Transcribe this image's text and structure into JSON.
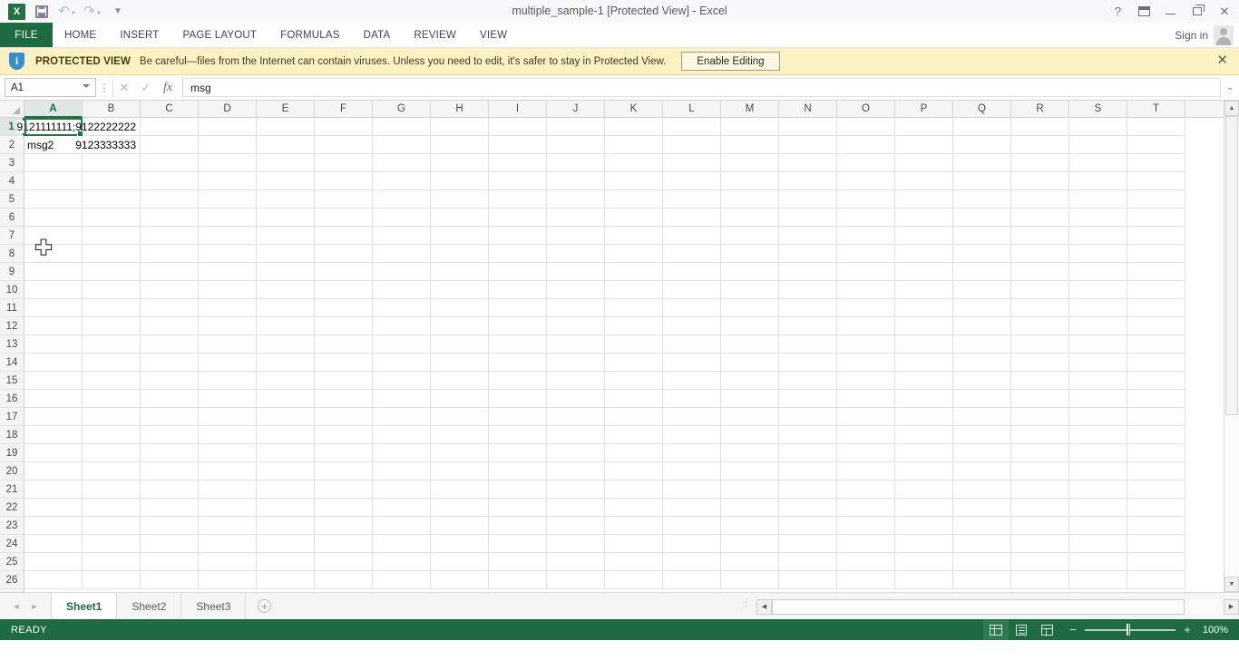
{
  "window": {
    "title": "multiple_sample-1  [Protected View] - Excel",
    "quick_access": [
      {
        "name": "excel-logo",
        "label": "X"
      },
      {
        "name": "save",
        "label": "Save"
      },
      {
        "name": "undo",
        "label": "Undo"
      },
      {
        "name": "redo",
        "label": "Redo"
      },
      {
        "name": "customize-qat",
        "label": "Customize Quick Access Toolbar"
      }
    ],
    "controls": [
      {
        "name": "help",
        "label": "?"
      },
      {
        "name": "ribbon-display-options",
        "label": ""
      },
      {
        "name": "minimize",
        "label": ""
      },
      {
        "name": "restore",
        "label": ""
      },
      {
        "name": "close",
        "label": "✕"
      }
    ]
  },
  "ribbon": {
    "file_tab": "FILE",
    "tabs": [
      "HOME",
      "INSERT",
      "PAGE LAYOUT",
      "FORMULAS",
      "DATA",
      "REVIEW",
      "VIEW"
    ],
    "signin": "Sign in"
  },
  "protected_view": {
    "label": "PROTECTED VIEW",
    "message": "Be careful—files from the Internet can contain viruses. Unless you need to edit, it's safer to stay in Protected View.",
    "button": "Enable Editing",
    "close": "✕"
  },
  "formula_bar": {
    "name_box": "A1",
    "cancel": "✕",
    "enter": "✓",
    "function_label": "fx",
    "value": "msg",
    "expand": "⌄"
  },
  "grid": {
    "columns": [
      "A",
      "B",
      "C",
      "D",
      "E",
      "F",
      "G",
      "H",
      "I",
      "J",
      "K",
      "L",
      "M",
      "N",
      "O",
      "P",
      "Q",
      "R",
      "S",
      "T"
    ],
    "rows": [
      1,
      2,
      3,
      4,
      5,
      6,
      7,
      8,
      9,
      10,
      11,
      12,
      13,
      14,
      15,
      16,
      17,
      18,
      19,
      20,
      21,
      22,
      23,
      24,
      25,
      26
    ],
    "active_cell": "A1",
    "data": [
      {
        "row": 1,
        "A": "msg",
        "B": "9121111111;9122222222"
      },
      {
        "row": 2,
        "A": "msg2",
        "B": "9123333333"
      }
    ]
  },
  "sheet_tabs": {
    "sheets": [
      "Sheet1",
      "Sheet2",
      "Sheet3"
    ],
    "active": "Sheet1",
    "add_label": "+",
    "nav_first": "◄",
    "nav_last": "►"
  },
  "status_bar": {
    "status": "READY",
    "views": [
      {
        "name": "normal-view",
        "label": "Normal"
      },
      {
        "name": "page-layout-view",
        "label": "Page Layout"
      },
      {
        "name": "page-break-preview",
        "label": "Page Break Preview"
      }
    ],
    "zoom_out": "−",
    "zoom_in": "+",
    "zoom_level": "100%"
  },
  "colors": {
    "accent": "#1e6b41",
    "protected_bg": "#fdf2c4"
  }
}
